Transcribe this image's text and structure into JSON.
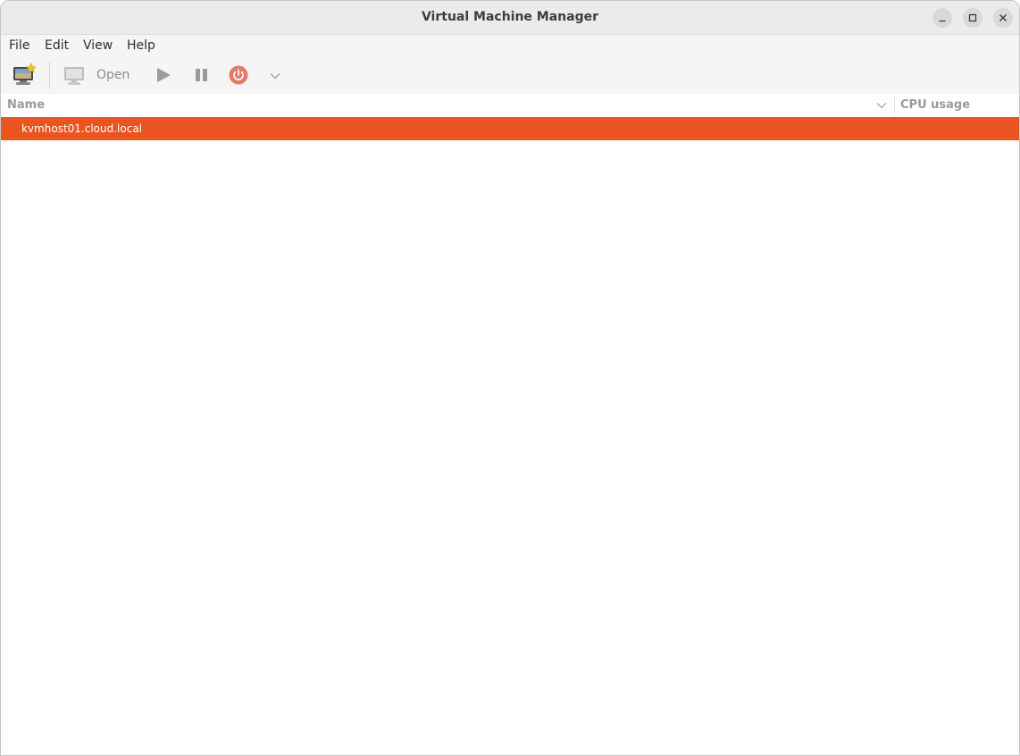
{
  "window": {
    "title": "Virtual Machine Manager"
  },
  "menubar": {
    "items": [
      {
        "label": "File"
      },
      {
        "label": "Edit"
      },
      {
        "label": "View"
      },
      {
        "label": "Help"
      }
    ]
  },
  "toolbar": {
    "open_label": "Open",
    "icons": {
      "new": "new-vm-icon",
      "open": "monitor-icon",
      "run": "play-icon",
      "pause": "pause-icon",
      "shutdown": "power-icon",
      "more": "chevron-down-icon"
    }
  },
  "columns": {
    "name": "Name",
    "cpu": "CPU usage"
  },
  "connections": [
    {
      "label": "kvmhost01.cloud.local",
      "selected": true
    }
  ],
  "colors": {
    "accent": "#e95420",
    "shutdown": "#e57a6a",
    "titlebar": "#ebebeb"
  }
}
